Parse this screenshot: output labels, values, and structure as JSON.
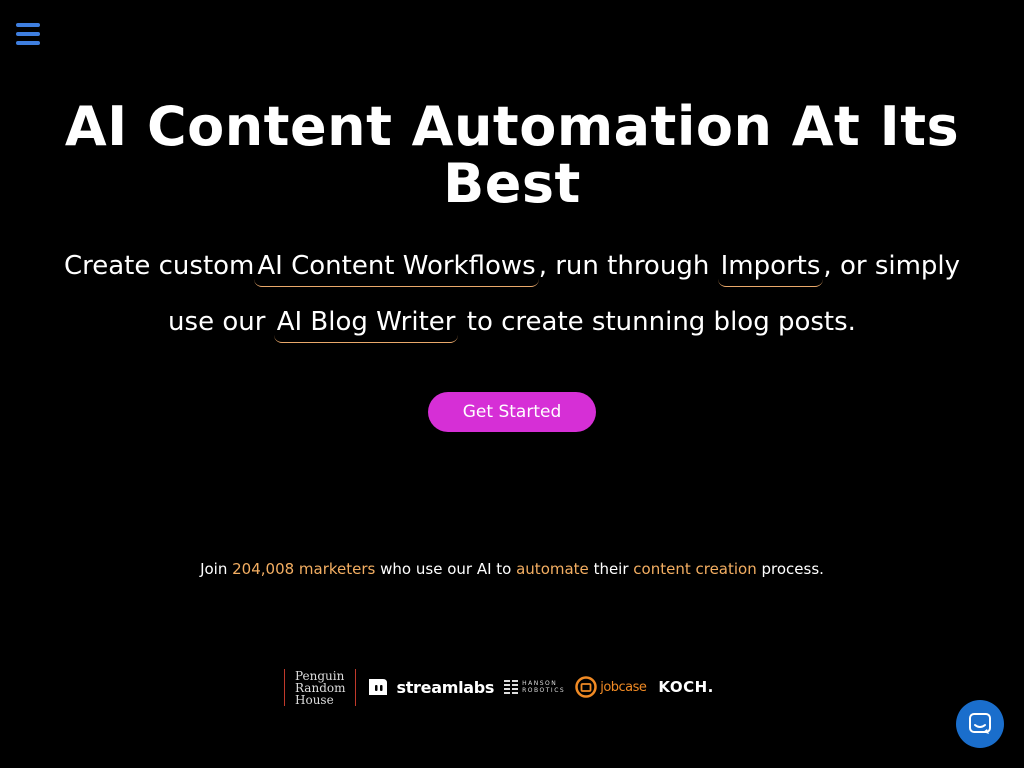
{
  "hero": {
    "title": "AI Content Automation At Its Best",
    "sub_1": "Create custom",
    "link_workflows": "AI Content Workflows",
    "sub_2": ", run through",
    "link_imports": "Imports",
    "sub_3": ", or simply use our",
    "link_blog_writer": "AI Blog Writer",
    "sub_4": "to create stunning blog posts."
  },
  "cta": {
    "label": "Get Started"
  },
  "join": {
    "t1": "Join",
    "count": "204,008 marketers",
    "t2": "who use our AI to",
    "automate": "automate",
    "t3": "their",
    "content_creation": "content creation",
    "t4": "process."
  },
  "logos": {
    "prh_1": "Penguin",
    "prh_2": "Random",
    "prh_3": "House",
    "streamlabs": "streamlabs",
    "hanson_1": "HANSON",
    "hanson_2": "ROBOTICS",
    "jobcase": "jobcase",
    "koch": "KOCH."
  },
  "colors": {
    "accent": "#f3ae62",
    "cta": "#d62fd6",
    "menu_icon": "#3f7fe0",
    "chat": "#1a6ecc"
  },
  "icons": {
    "menu": "hamburger-menu-icon",
    "chat": "chat-icon"
  }
}
